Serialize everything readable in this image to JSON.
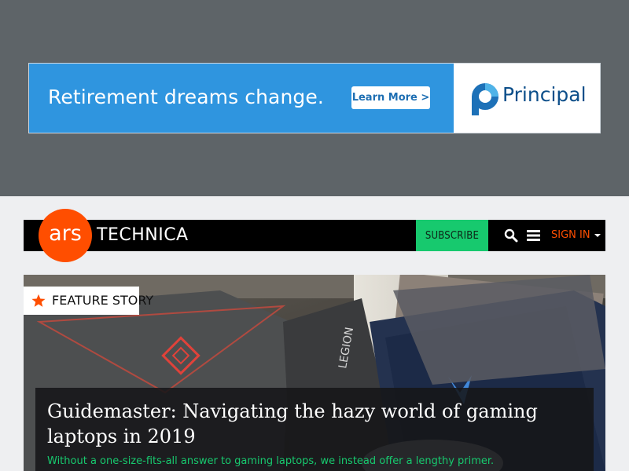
{
  "ad": {
    "headline": "Retirement dreams change.",
    "cta_label": "Learn More >",
    "brand_name": "Principal",
    "brand_logo_icon": "principal-logo-icon",
    "colors": {
      "banner_bg": "#2f95df",
      "cta_text": "#1e6fb3",
      "brand_text": "#0d4f8a"
    }
  },
  "header": {
    "logo_ars": "ars",
    "logo_technica": "TECHNICA",
    "subscribe_label": "SUBSCRIBE",
    "search_icon": "search-icon",
    "menu_icon": "hamburger-menu-icon",
    "signin_label": "SIGN IN",
    "colors": {
      "brand_orange": "#ff4e00",
      "subscribe_green": "#17c96e",
      "bar": "#000000"
    }
  },
  "feature": {
    "tag_icon": "star-icon",
    "tag_label": "FEATURE STORY",
    "headline": "Guidemaster: Navigating the hazy world of gaming laptops in 2019",
    "dek": "Without a one-size-fits-all answer to gaming laptops, we instead offer a lengthy primer.",
    "colors": {
      "dek": "#17c96e"
    }
  }
}
